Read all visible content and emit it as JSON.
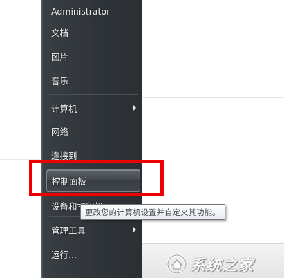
{
  "start_menu": {
    "items": [
      {
        "label": "Administrator",
        "has_submenu": false
      },
      {
        "label": "文档",
        "has_submenu": false
      },
      {
        "label": "图片",
        "has_submenu": false
      },
      {
        "label": "音乐",
        "has_submenu": false
      },
      {
        "label": "计算机",
        "has_submenu": true
      },
      {
        "label": "网络",
        "has_submenu": false
      },
      {
        "label": "连接到",
        "has_submenu": false
      },
      {
        "label": "控制面板",
        "has_submenu": false
      },
      {
        "label": "设备和打印机",
        "has_submenu": false
      },
      {
        "label": "管理工具",
        "has_submenu": true
      },
      {
        "label": "运行...",
        "has_submenu": false
      }
    ],
    "highlighted_item": "控制面板"
  },
  "tooltip": {
    "text": "更改您的计算机设置并自定义其功能。"
  },
  "annotation": {
    "color": "#ee0000"
  },
  "watermark": {
    "text": "系统之家",
    "logo": "house-logo-icon"
  },
  "colors": {
    "menu_background": "#2f3439",
    "menu_text": "#f2f2f2",
    "highlight_border": "#7d8389"
  }
}
